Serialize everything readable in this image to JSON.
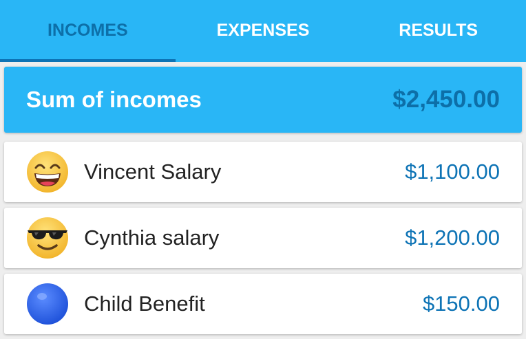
{
  "tabs": [
    {
      "label": "INCOMES",
      "active": true
    },
    {
      "label": "EXPENSES",
      "active": false
    },
    {
      "label": "RESULTS",
      "active": false
    }
  ],
  "summary": {
    "label": "Sum of incomes",
    "value": "$2,450.00"
  },
  "incomes": [
    {
      "icon": "grinning-face-icon",
      "name": "Vincent Salary",
      "amount": "$1,100.00"
    },
    {
      "icon": "sunglasses-face-icon",
      "name": "Cynthia salary",
      "amount": "$1,200.00"
    },
    {
      "icon": "blue-circle-icon",
      "name": "Child Benefit",
      "amount": "$150.00"
    }
  ],
  "colors": {
    "primary": "#29b6f6",
    "accent_dark": "#0d73b5",
    "background": "#eeeeee"
  }
}
